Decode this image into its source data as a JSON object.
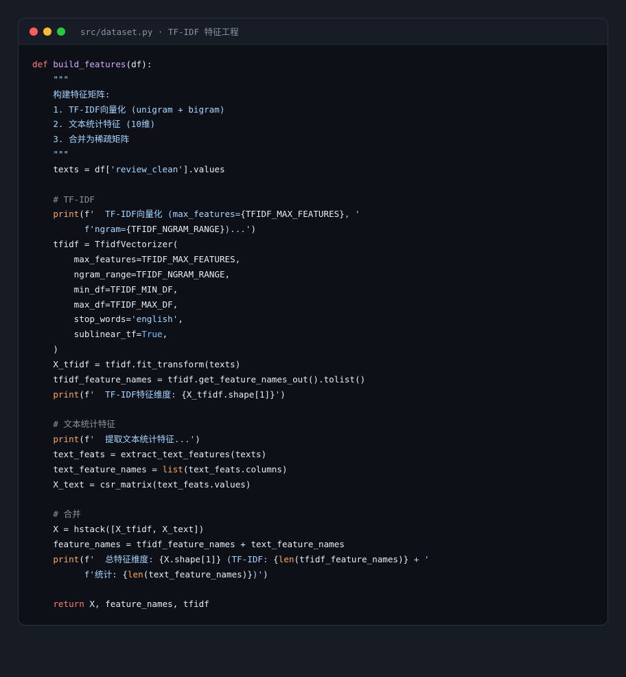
{
  "window": {
    "title": "src/dataset.py · TF-IDF 特征工程",
    "controls": [
      {
        "name": "close",
        "color": "#ff5f57"
      },
      {
        "name": "minimize",
        "color": "#febc2e"
      },
      {
        "name": "maximize",
        "color": "#28c840"
      }
    ]
  },
  "code": {
    "lines": [
      [
        [
          "kw",
          "def"
        ],
        [
          "plain",
          " "
        ],
        [
          "fn",
          "build_features"
        ],
        [
          "plain",
          "(df):"
        ]
      ],
      [
        [
          "str",
          "    \"\"\""
        ]
      ],
      [
        [
          "str",
          "    构建特征矩阵:"
        ]
      ],
      [
        [
          "str",
          "    1. TF-IDF向量化 (unigram + bigram)"
        ]
      ],
      [
        [
          "str",
          "    2. 文本统计特征 (10维)"
        ]
      ],
      [
        [
          "str",
          "    3. 合并为稀疏矩阵"
        ]
      ],
      [
        [
          "str",
          "    \"\"\""
        ]
      ],
      [
        [
          "plain",
          "    texts = df["
        ],
        [
          "str",
          "'review_clean'"
        ],
        [
          "plain",
          "].values"
        ]
      ],
      [
        [
          "plain",
          ""
        ]
      ],
      [
        [
          "cmt",
          "    # TF-IDF"
        ]
      ],
      [
        [
          "plain",
          "    "
        ],
        [
          "bi",
          "print"
        ],
        [
          "plain",
          "(f"
        ],
        [
          "str",
          "'  TF-IDF向量化 (max_features="
        ],
        [
          "plain",
          "{TFIDF_MAX_FEATURES}"
        ],
        [
          "str",
          ", '"
        ]
      ],
      [
        [
          "str",
          "          f'ngram="
        ],
        [
          "plain",
          "{TFIDF_NGRAM_RANGE}"
        ],
        [
          "str",
          ")...'"
        ],
        [
          "plain",
          ")"
        ]
      ],
      [
        [
          "plain",
          "    tfidf = TfidfVectorizer("
        ]
      ],
      [
        [
          "plain",
          "        max_features=TFIDF_MAX_FEATURES,"
        ]
      ],
      [
        [
          "plain",
          "        ngram_range=TFIDF_NGRAM_RANGE,"
        ]
      ],
      [
        [
          "plain",
          "        min_df=TFIDF_MIN_DF,"
        ]
      ],
      [
        [
          "plain",
          "        max_df=TFIDF_MAX_DF,"
        ]
      ],
      [
        [
          "plain",
          "        stop_words="
        ],
        [
          "str",
          "'english'"
        ],
        [
          "plain",
          ","
        ]
      ],
      [
        [
          "plain",
          "        sublinear_tf="
        ],
        [
          "num",
          "True"
        ],
        [
          "plain",
          ","
        ]
      ],
      [
        [
          "plain",
          "    )"
        ]
      ],
      [
        [
          "plain",
          "    X_tfidf = tfidf.fit_transform(texts)"
        ]
      ],
      [
        [
          "plain",
          "    tfidf_feature_names = tfidf.get_feature_names_out().tolist()"
        ]
      ],
      [
        [
          "plain",
          "    "
        ],
        [
          "bi",
          "print"
        ],
        [
          "plain",
          "(f"
        ],
        [
          "str",
          "'  TF-IDF特征维度: "
        ],
        [
          "plain",
          "{X_tfidf.shape[1]}"
        ],
        [
          "str",
          "'"
        ],
        [
          "plain",
          ")"
        ]
      ],
      [
        [
          "plain",
          ""
        ]
      ],
      [
        [
          "cmt",
          "    # 文本统计特征"
        ]
      ],
      [
        [
          "plain",
          "    "
        ],
        [
          "bi",
          "print"
        ],
        [
          "plain",
          "(f"
        ],
        [
          "str",
          "'  提取文本统计特征...'"
        ],
        [
          "plain",
          ")"
        ]
      ],
      [
        [
          "plain",
          "    text_feats = extract_text_features(texts)"
        ]
      ],
      [
        [
          "plain",
          "    text_feature_names = "
        ],
        [
          "bi",
          "list"
        ],
        [
          "plain",
          "(text_feats.columns)"
        ]
      ],
      [
        [
          "plain",
          "    X_text = csr_matrix(text_feats.values)"
        ]
      ],
      [
        [
          "plain",
          ""
        ]
      ],
      [
        [
          "cmt",
          "    # 合并"
        ]
      ],
      [
        [
          "plain",
          "    X = hstack([X_tfidf, X_text])"
        ]
      ],
      [
        [
          "plain",
          "    feature_names = tfidf_feature_names + text_feature_names"
        ]
      ],
      [
        [
          "plain",
          "    "
        ],
        [
          "bi",
          "print"
        ],
        [
          "plain",
          "(f"
        ],
        [
          "str",
          "'  总特征维度: "
        ],
        [
          "plain",
          "{X.shape[1]}"
        ],
        [
          "str",
          " (TF-IDF: "
        ],
        [
          "plain",
          "{"
        ],
        [
          "bi",
          "len"
        ],
        [
          "plain",
          "(tfidf_feature_names)}"
        ],
        [
          "str",
          " + '"
        ]
      ],
      [
        [
          "str",
          "          f'统计: "
        ],
        [
          "plain",
          "{"
        ],
        [
          "bi",
          "len"
        ],
        [
          "plain",
          "(text_feature_names)}"
        ],
        [
          "str",
          ")'"
        ],
        [
          "plain",
          ")"
        ]
      ],
      [
        [
          "plain",
          ""
        ]
      ],
      [
        [
          "plain",
          "    "
        ],
        [
          "kw",
          "return"
        ],
        [
          "plain",
          " X, feature_names, tfidf"
        ]
      ]
    ]
  }
}
